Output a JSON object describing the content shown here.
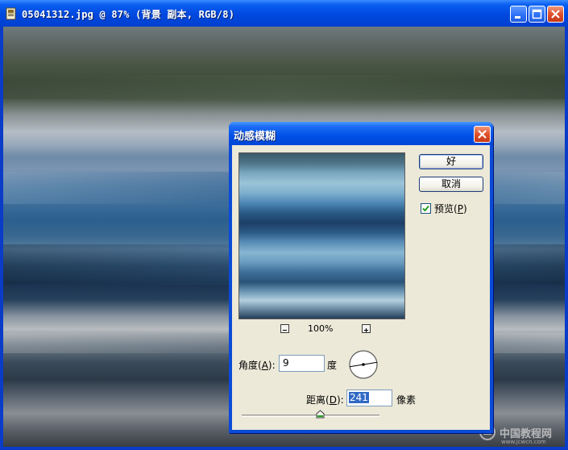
{
  "window": {
    "title": "05041312.jpg @ 87% (背景 副本, RGB/8)",
    "controls": [
      "minimize-icon",
      "maximize-icon",
      "close-icon"
    ]
  },
  "dialog": {
    "title": "动感模糊",
    "ok_label": "好",
    "cancel_label": "取消",
    "preview": {
      "label": "预览(",
      "key": "P",
      "suffix": ")",
      "checked": true
    },
    "zoom_level": "100%",
    "angle": {
      "label": "角度(",
      "key": "A",
      "suffix": "):",
      "value": "9",
      "unit": "度"
    },
    "distance": {
      "label": "距离(",
      "key": "D",
      "suffix": "):",
      "value": "241",
      "unit": "像素",
      "slider_fraction": 0.6
    }
  },
  "watermark": {
    "text": "中国教程网",
    "url": "www.jcwcn.com"
  },
  "colors": {
    "titlebar": "#0054e3",
    "dialog_body": "#ece9d8",
    "selection": "#316ac5",
    "close_button": "#e0502a"
  }
}
